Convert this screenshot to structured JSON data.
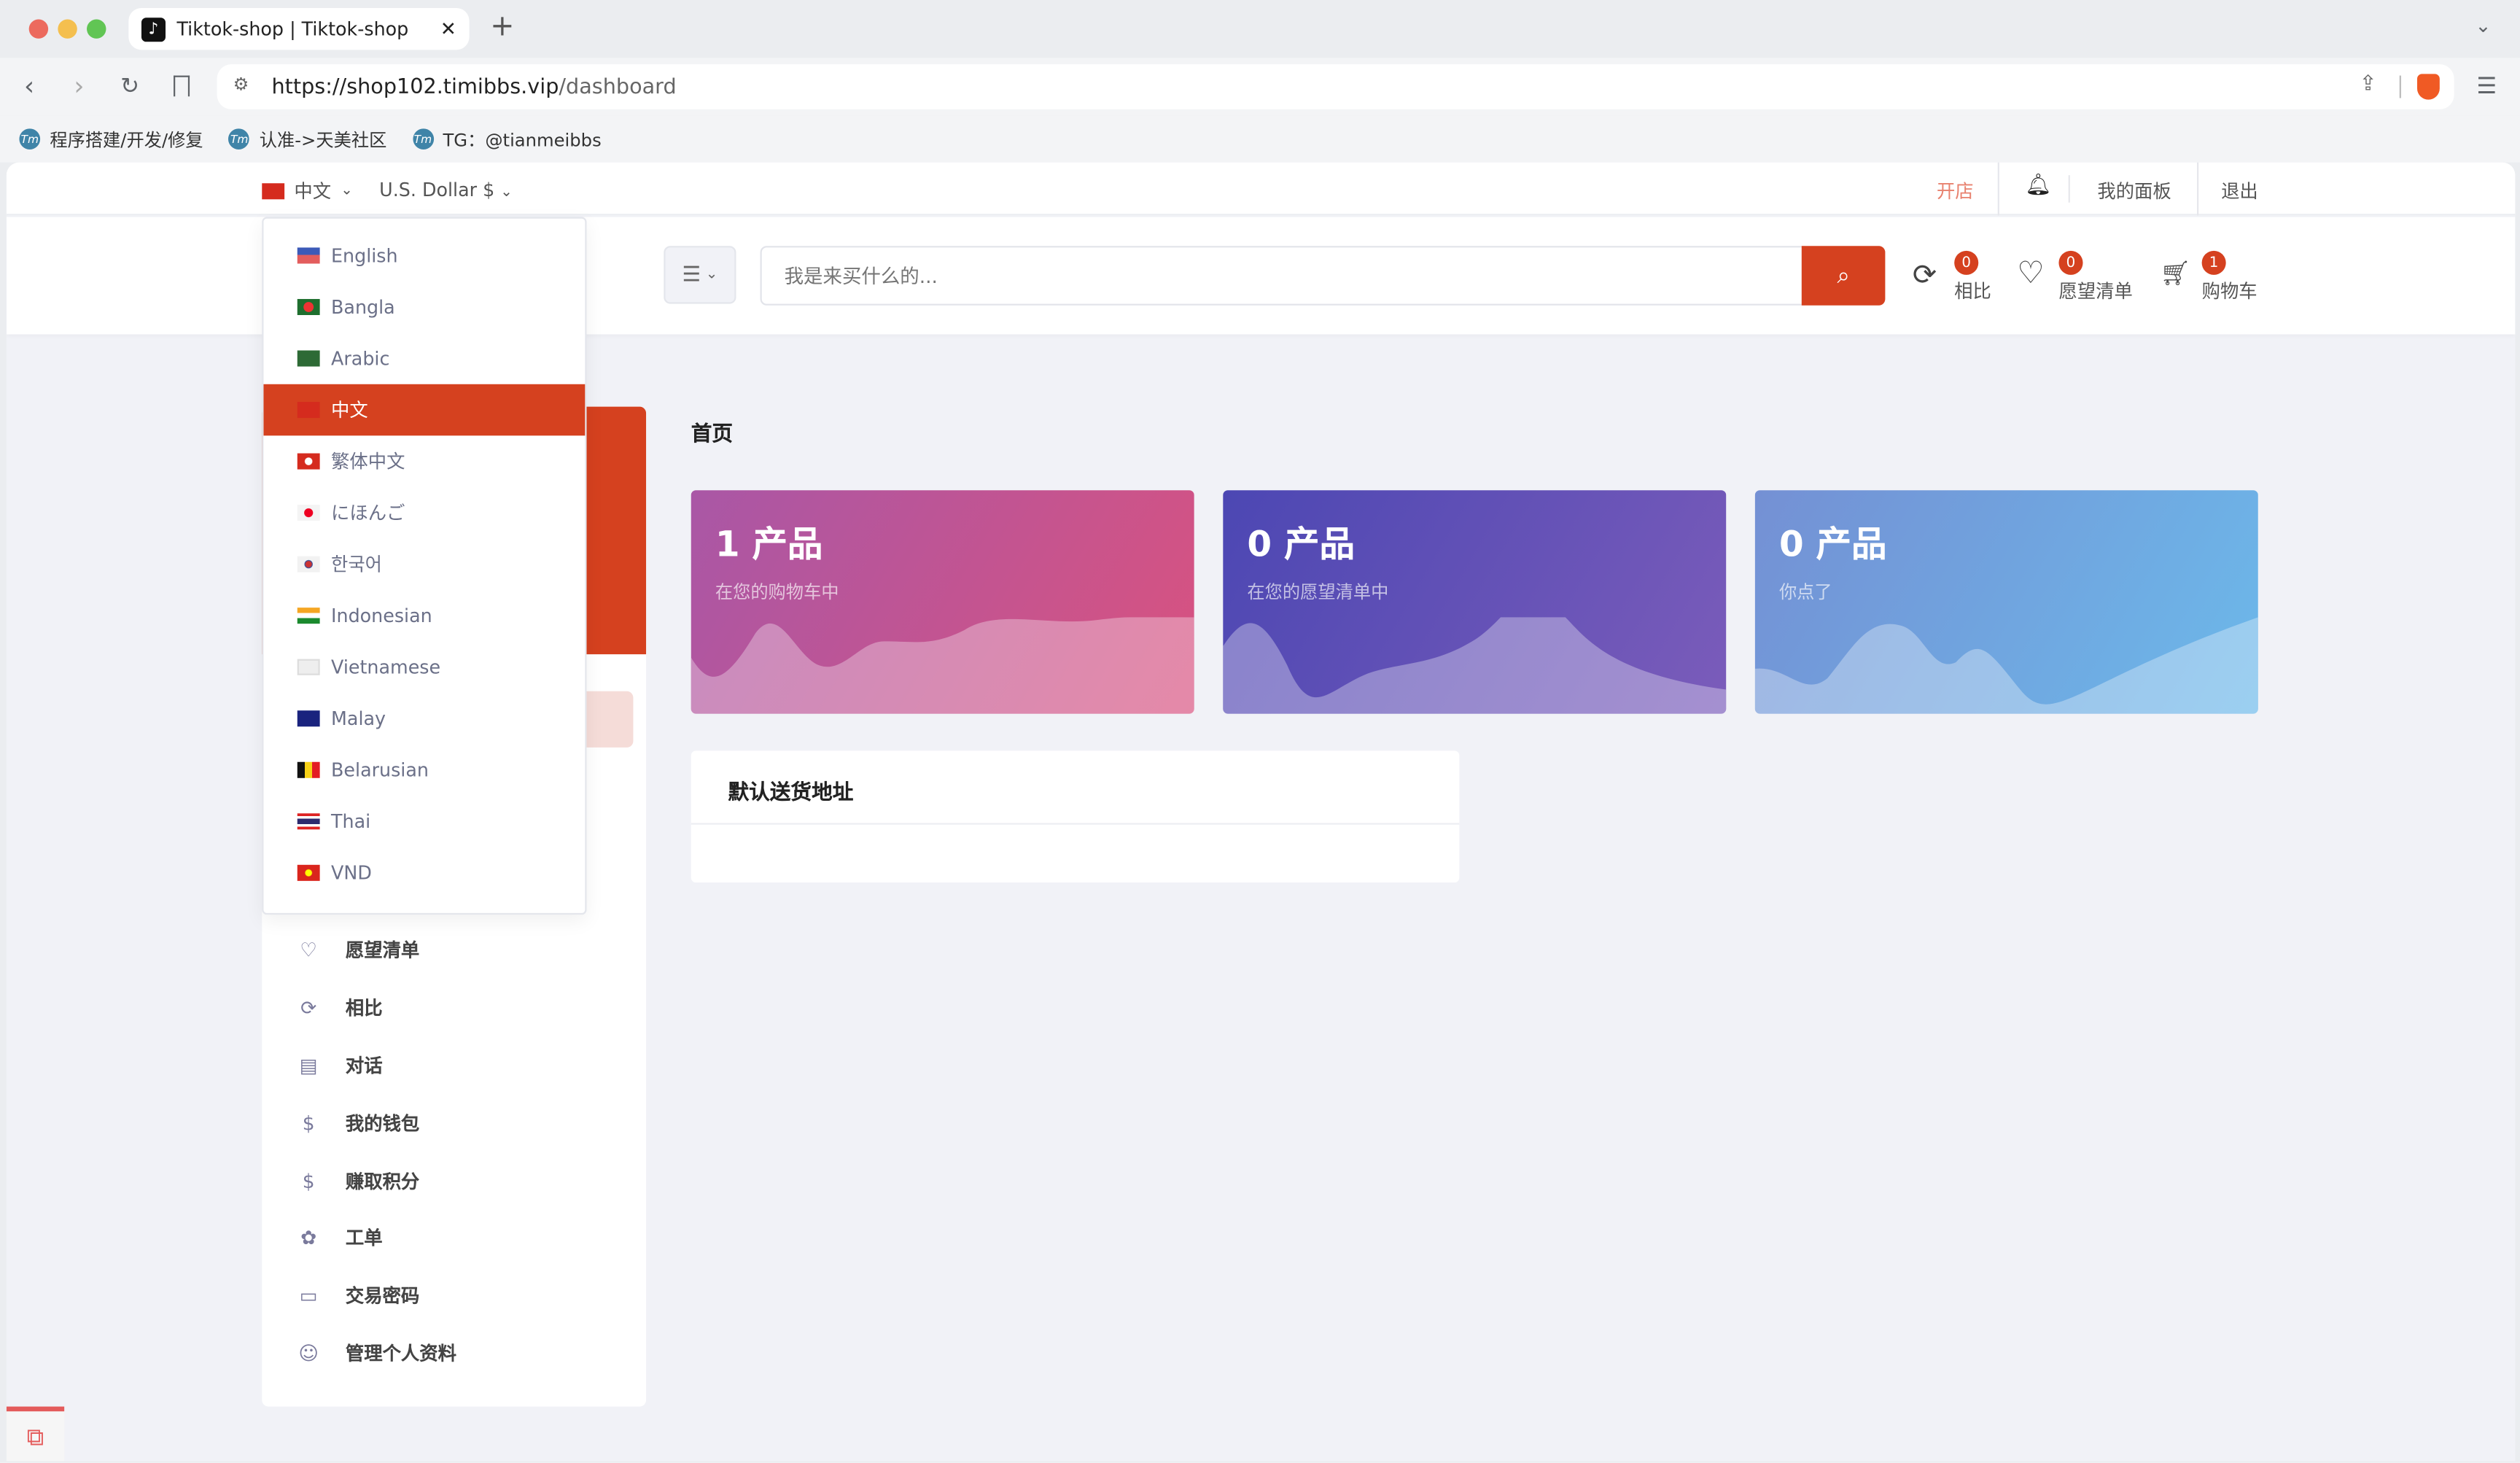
{
  "browser": {
    "tab_title": "Tiktok-shop | Tiktok-shop",
    "url_host": "https://shop102.timibbs.vip",
    "url_path": "/dashboard",
    "bookmarks": [
      {
        "label": "程序搭建/开发/修复"
      },
      {
        "label": "认准->天美社区"
      },
      {
        "label": "TG：@tianmeibbs"
      }
    ]
  },
  "topbar": {
    "language": "中文",
    "currency": "U.S. Dollar $",
    "open_shop": "开店",
    "dashboard": "我的面板",
    "logout": "退出"
  },
  "header": {
    "search_placeholder": "我是来买什么的...",
    "compare": {
      "label": "相比",
      "count": "0"
    },
    "wishlist": {
      "label": "愿望清单",
      "count": "0"
    },
    "cart": {
      "label": "购物车",
      "count": "1"
    }
  },
  "language_menu": {
    "selected": "中文",
    "items": [
      {
        "label": "English",
        "flag": "us"
      },
      {
        "label": "Bangla",
        "flag": "bd"
      },
      {
        "label": "Arabic",
        "flag": "sa"
      },
      {
        "label": "中文",
        "flag": "cn"
      },
      {
        "label": "繁体中文",
        "flag": "hk"
      },
      {
        "label": "にほんご",
        "flag": "jp"
      },
      {
        "label": "한국어",
        "flag": "kr"
      },
      {
        "label": "Indonesian",
        "flag": "in"
      },
      {
        "label": "Vietnamese",
        "flag": "vi"
      },
      {
        "label": "Malay",
        "flag": "my"
      },
      {
        "label": "Belarusian",
        "flag": "be"
      },
      {
        "label": "Thai",
        "flag": "th"
      },
      {
        "label": "VND",
        "flag": "vn"
      }
    ]
  },
  "sidebar": {
    "items": [
      {
        "label": "愿望清单",
        "icon": "heart-icon"
      },
      {
        "label": "相比",
        "icon": "refresh-icon"
      },
      {
        "label": "对话",
        "icon": "chat-icon"
      },
      {
        "label": "我的钱包",
        "icon": "dollar-icon"
      },
      {
        "label": "赚取积分",
        "icon": "dollar-icon"
      },
      {
        "label": "工单",
        "icon": "support-icon"
      },
      {
        "label": "交易密码",
        "icon": "wallet-icon"
      },
      {
        "label": "管理个人资料",
        "icon": "user-icon"
      }
    ]
  },
  "main": {
    "title": "首页",
    "cards": [
      {
        "value": "1 产品",
        "caption": "在您的购物车中"
      },
      {
        "value": "0 产品",
        "caption": "在您的愿望清单中"
      },
      {
        "value": "0 产品",
        "caption": "你点了"
      }
    ],
    "address_title": "默认送货地址"
  },
  "colors": {
    "accent": "#d5411f",
    "open_shop": "#e8826f"
  }
}
